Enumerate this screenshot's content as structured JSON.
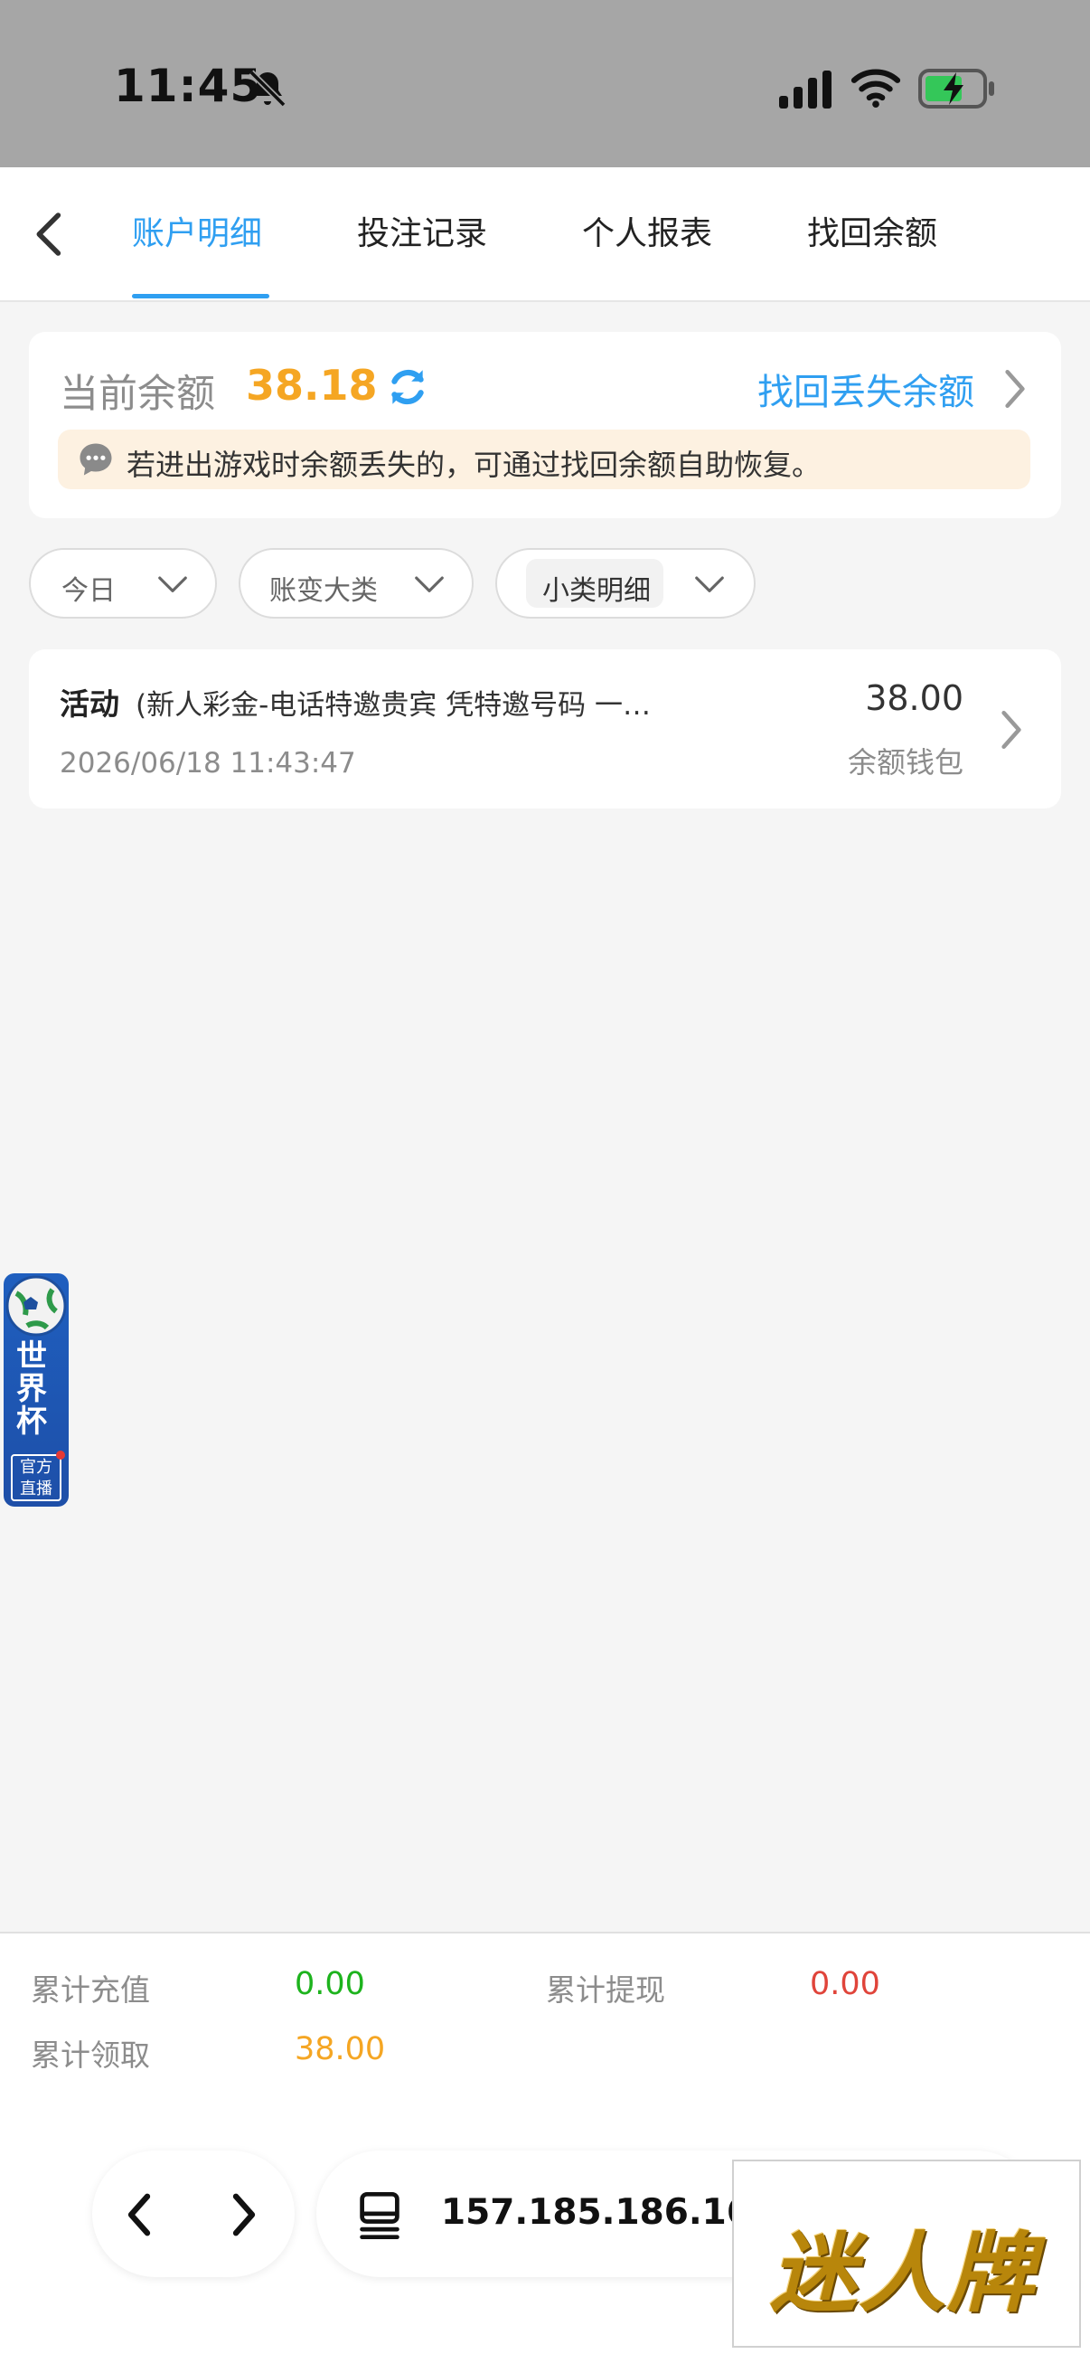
{
  "status_bar": {
    "time": "11:45"
  },
  "nav": {
    "tabs": [
      {
        "label": "账户明细",
        "active": true
      },
      {
        "label": "投注记录",
        "active": false
      },
      {
        "label": "个人报表",
        "active": false
      },
      {
        "label": "找回余额",
        "active": false
      }
    ]
  },
  "balance": {
    "label": "当前余额",
    "value": "38.18",
    "recover_link": "找回丢失余额",
    "tip": "若进出游戏时余额丢失的，可通过找回余额自助恢复。"
  },
  "filters": [
    {
      "label": "今日"
    },
    {
      "label": "账变大类"
    },
    {
      "label": "小类明细"
    }
  ],
  "records": [
    {
      "type": "活动",
      "description": "(新人彩金-电话特邀贵宾 凭特邀号码 一…",
      "time": "2026/06/18 11:43:47",
      "amount": "38.00",
      "wallet": "余额钱包"
    }
  ],
  "floating_badge": {
    "title": "世界杯",
    "subtitle": "官方直播"
  },
  "summary": {
    "recharge_label": "累计充值",
    "recharge_value": "0.00",
    "withdraw_label": "累计提现",
    "withdraw_value": "0.00",
    "claim_label": "累计领取",
    "claim_value": "38.00"
  },
  "browser": {
    "address": "157.185.186.167"
  },
  "watermark": "迷人牌",
  "colors": {
    "accent": "#2f9ff1",
    "orange": "#f5a623",
    "green": "#1db31d",
    "red": "#e0443a"
  }
}
